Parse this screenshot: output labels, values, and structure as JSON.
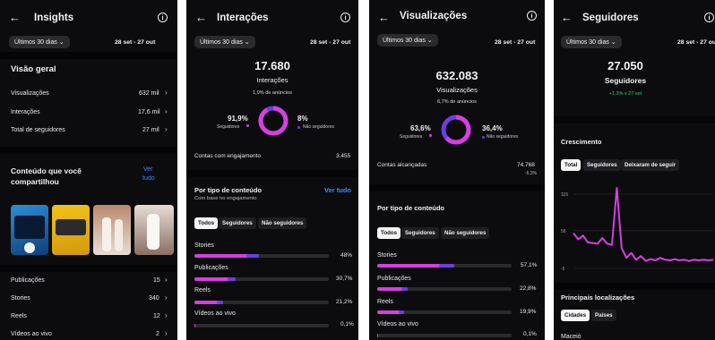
{
  "colors": {
    "accent": "#d63fe0",
    "accent2": "#6a3fe0",
    "link": "#3d8bff",
    "positive": "#3ec46d"
  },
  "common": {
    "back_glyph": "←",
    "info_glyph": "i",
    "chip_label": "Últimos 30 dias ⌄",
    "range": "28 set - 27 out",
    "chevron": "›"
  },
  "insights": {
    "title": "Insights",
    "overview_title": "Visão geral",
    "overview": [
      {
        "label": "Visualizações",
        "value": "632 mil"
      },
      {
        "label": "Interações",
        "value": "17,6 mil"
      },
      {
        "label": "Total de seguidores",
        "value": "27 mil"
      }
    ],
    "content_title_1": "Conteúdo que você",
    "content_title_2": "compartilhou",
    "see_all_1": "Ver",
    "see_all_2": "tudo",
    "content_rows": [
      {
        "label": "Publicações",
        "value": "15"
      },
      {
        "label": "Stories",
        "value": "340"
      },
      {
        "label": "Reels",
        "value": "12"
      },
      {
        "label": "Vídeos ao vivo",
        "value": "2"
      }
    ]
  },
  "interactions": {
    "title": "Interações",
    "total": "17.680",
    "total_label": "Interações",
    "ads_note": "1,9% de anúncios",
    "followers_pct": "91,9%",
    "followers_label": "Seguidores",
    "non_followers_pct": "8%",
    "non_followers_label": "Não seguidores",
    "donut_fraction": 0.919,
    "engaged_label": "Contas com engajamento",
    "engaged_value": "3.455",
    "by_type_title": "Por tipo de conteúdo",
    "by_type_sub": "Com base no engajamento",
    "see_all": "Ver tudo",
    "tabs": [
      "Todos",
      "Seguidores",
      "Não seguidores"
    ],
    "types": [
      {
        "label": "Stories",
        "value": "48%",
        "fraction": 0.48
      },
      {
        "label": "Publicações",
        "value": "30,7%",
        "fraction": 0.307
      },
      {
        "label": "Reels",
        "value": "21,2%",
        "fraction": 0.212
      },
      {
        "label": "Vídeos ao vivo",
        "value": "0,1%",
        "fraction": 0.001
      }
    ]
  },
  "views": {
    "title": "Visualizações",
    "total": "632.083",
    "total_label": "Visualizações",
    "ads_note": "6,7% de anúncios",
    "followers_pct": "63,6%",
    "followers_label": "Seguidores",
    "non_followers_pct": "36,4%",
    "non_followers_label": "Não seguidores",
    "donut_fraction": 0.636,
    "reached_label": "Contas alcançadas",
    "reached_value": "74.768",
    "reached_change": "-6,3%",
    "by_type_title": "Por tipo de conteúdo",
    "tabs": [
      "Todos",
      "Seguidores",
      "Não seguidores"
    ],
    "types": [
      {
        "label": "Stories",
        "value": "57,1%",
        "fraction": 0.571
      },
      {
        "label": "Publicações",
        "value": "22,8%",
        "fraction": 0.228
      },
      {
        "label": "Reels",
        "value": "19,9%",
        "fraction": 0.199
      },
      {
        "label": "Vídeos ao vivo",
        "value": "0,1%",
        "fraction": 0.001
      }
    ]
  },
  "followers": {
    "title": "Seguidores",
    "total": "27.050",
    "total_label": "Seguidores",
    "change": "+1,3% x 27 set",
    "growth_title": "Crescimento",
    "tabs": [
      "Total",
      "Seguidores",
      "Deixaram de seguir"
    ],
    "locations_title": "Principais localizações",
    "loc_tabs": [
      "Cidades",
      "Países"
    ],
    "first_city": "Maceió"
  },
  "chart_data": {
    "type": "line",
    "series": [
      {
        "values": [
          52,
          42,
          48,
          37,
          36,
          35,
          44,
          35,
          33,
          125,
          28,
          12,
          20,
          9,
          15,
          7,
          10,
          8,
          12,
          9,
          8,
          10,
          8,
          9,
          7,
          9,
          8,
          9,
          8,
          9
        ]
      }
    ],
    "yticks": [
      "115",
      "56",
      "-5"
    ],
    "ylim": [
      -5,
      125
    ]
  }
}
